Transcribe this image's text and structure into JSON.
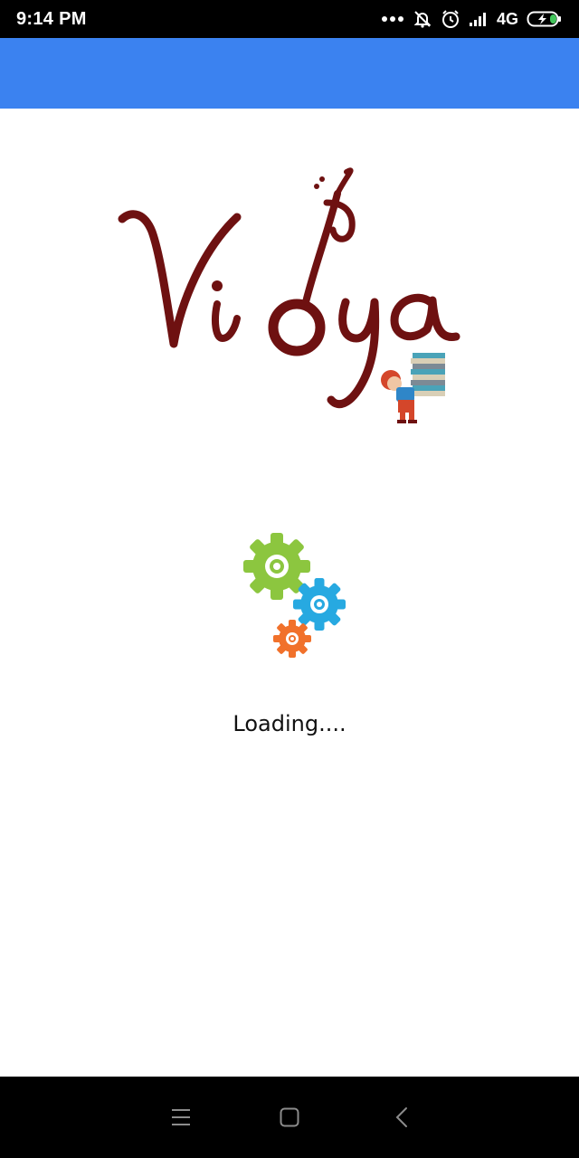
{
  "status_bar": {
    "time": "9:14 PM",
    "network": "4G",
    "icons": [
      "more-dots-icon",
      "notifications-off-icon",
      "alarm-icon",
      "signal-icon",
      "battery-charging-icon"
    ]
  },
  "app_bar": {
    "color": "#3b82f0"
  },
  "splash": {
    "logo_text": "Vidya",
    "loading_text": "Loading...."
  },
  "nav_bar": {
    "buttons": [
      "menu-icon",
      "home-icon",
      "back-icon"
    ]
  },
  "colors": {
    "logo": "#6e1111",
    "gear_green": "#8cc63f",
    "gear_blue": "#27a9e1",
    "gear_orange": "#f1712b"
  }
}
